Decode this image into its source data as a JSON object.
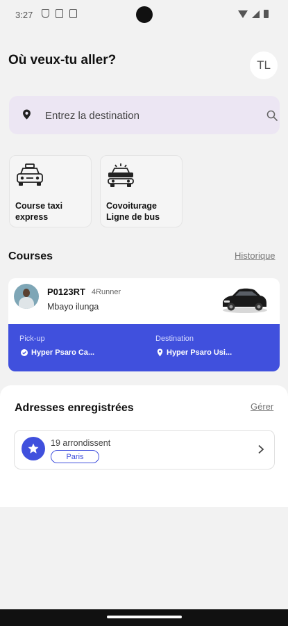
{
  "status_bar": {
    "time": "3:27",
    "left_icons": [
      "shield-icon",
      "a-badge-icon",
      "sim-card-icon"
    ],
    "right_icons": [
      "wifi-icon",
      "signal-icon",
      "battery-icon"
    ]
  },
  "header": {
    "greeting": "Où veux-tu aller?",
    "avatar_initials": "TL"
  },
  "search": {
    "placeholder": "Entrez la destination",
    "leading_icon": "map-pin-icon",
    "trailing_icon": "search-icon"
  },
  "services": [
    {
      "label_line1": "Course taxi",
      "label_line2": "express",
      "icon": "taxi-icon"
    },
    {
      "label_line1": "Covoiturage",
      "label_line2": "Ligne de bus",
      "icon": "bus-car-icon"
    }
  ],
  "courses": {
    "title": "Courses",
    "history_link": "Historique",
    "card": {
      "plate": "P0123RT",
      "model": "4Runner",
      "driver_name": "Mbayo ilunga",
      "pickup_label": "Pick-up",
      "pickup_value": "Hyper Psaro Ca...",
      "destination_label": "Destination",
      "destination_value": "Hyper Psaro Usi...",
      "accent_color": "#4050dd"
    }
  },
  "addresses": {
    "title": "Adresses enregistrées",
    "manage_link": "Gérer",
    "items": [
      {
        "name": "19 arrondissent",
        "chip": "Paris",
        "icon": "star-icon"
      }
    ]
  }
}
